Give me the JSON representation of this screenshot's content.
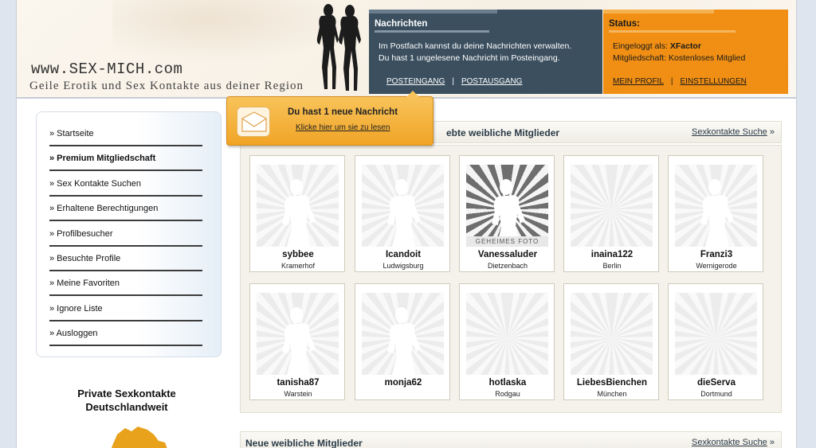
{
  "header": {
    "logo_url": "www.SEX-MICH.com",
    "tagline": "Geile Erotik und Sex Kontakte aus deiner Region"
  },
  "messages": {
    "title": "Nachrichten",
    "line1": "Im Postfach kannst du deine Nachrichten verwalten.",
    "line2": "Du hast 1 ungelesene Nachricht im Posteingang.",
    "inbox_label": "POSTEINGANG",
    "outbox_label": "POSTAUSGANG",
    "separator": "|"
  },
  "status": {
    "title": "Status:",
    "logged_in_prefix": "Eingeloggt als:",
    "username": "XFactor",
    "membership": "Mitgliedschaft: Kostenloses Mitglied",
    "profile_label": "MEIN PROFIL",
    "settings_label": "EINSTELLUNGEN",
    "separator": "|"
  },
  "popup": {
    "title": "Du hast 1 neue Nachricht",
    "link": "Klicke hier um sie zu lesen"
  },
  "sidebar": {
    "items": [
      {
        "label": "» Startseite",
        "bold": false
      },
      {
        "label": "» Premium Mitgliedschaft",
        "bold": true
      },
      {
        "label": "» Sex Kontakte Suchen",
        "bold": false
      },
      {
        "label": "» Erhaltene Berechtigungen",
        "bold": false
      },
      {
        "label": "» Profilbesucher",
        "bold": false
      },
      {
        "label": "» Besuchte Profile",
        "bold": false
      },
      {
        "label": "» Meine Favoriten",
        "bold": false
      },
      {
        "label": "» Ignore Liste",
        "bold": false
      },
      {
        "label": "» Ausloggen",
        "bold": false
      }
    ],
    "promo_line1": "Private Sexkontakte",
    "promo_line2": "Deutschlandweit"
  },
  "section_popular": {
    "title_visible": "ebte weibliche Mitglieder",
    "more_link": "Sexkontakte Suche",
    "more_arrow": "»"
  },
  "section_new": {
    "title": "Neue weibliche Mitglieder",
    "more_link": "Sexkontakte Suche",
    "more_arrow": "»"
  },
  "members": [
    {
      "name": "sybbee",
      "city": "Kramerhof",
      "photo": "silhouette"
    },
    {
      "name": "Icandoit",
      "city": "Ludwigsburg",
      "photo": "silhouette"
    },
    {
      "name": "Vanessaluder",
      "city": "Dietzenbach",
      "photo": "secret",
      "photo_label": "GEHEIMES FOTO"
    },
    {
      "name": "inaina122",
      "city": "Berlin",
      "photo": "legs"
    },
    {
      "name": "Franzi3",
      "city": "Wernigerode",
      "photo": "silhouette"
    },
    {
      "name": "tanisha87",
      "city": "Warstein",
      "photo": "silhouette"
    },
    {
      "name": "monja62",
      "city": "",
      "photo": "silhouette"
    },
    {
      "name": "hotlaska",
      "city": "Rodgau",
      "photo": "dark"
    },
    {
      "name": "LiebesBienchen",
      "city": "München",
      "photo": "jeans"
    },
    {
      "name": "dieServa",
      "city": "Dortmund",
      "photo": "blur"
    }
  ],
  "colors": {
    "messages_bg": "#3b4f5f",
    "status_bg": "#f08f14",
    "popup_bg": "#f5b03e"
  }
}
